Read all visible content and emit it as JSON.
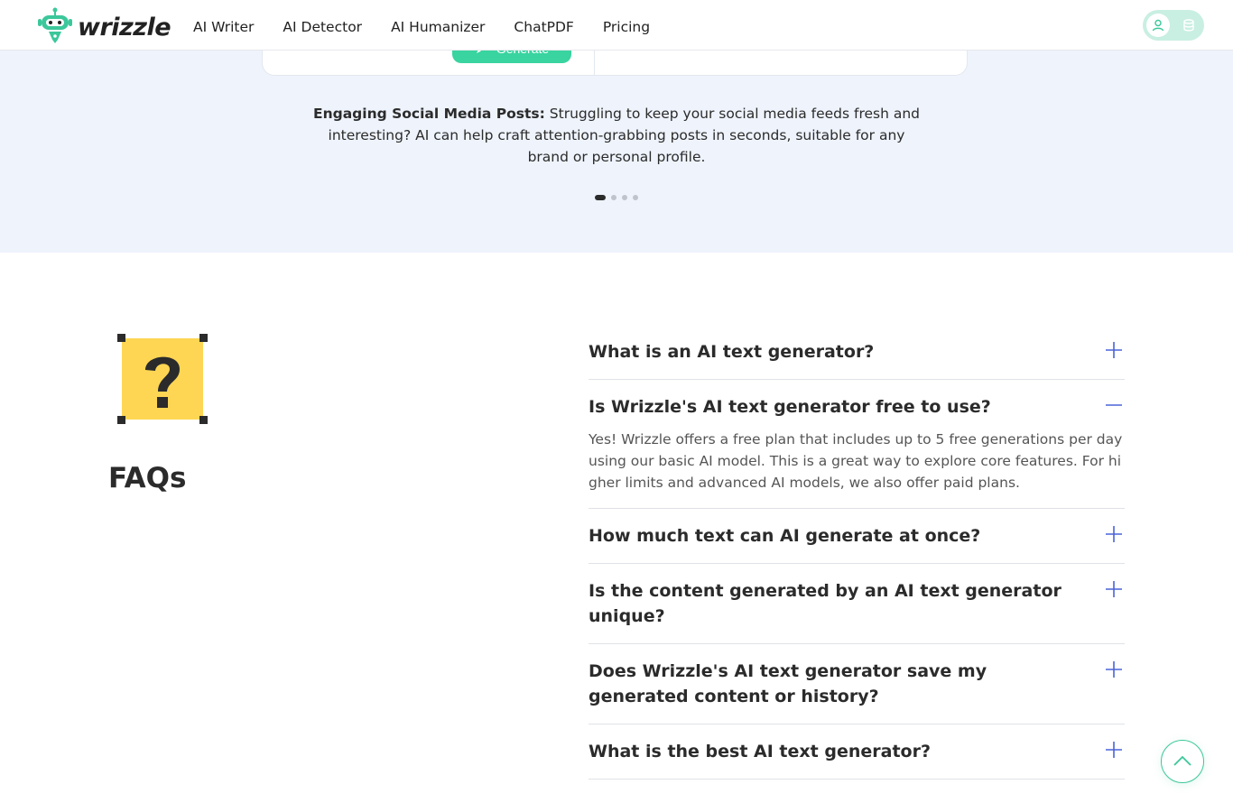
{
  "header": {
    "logo_text": "wrizzle",
    "nav": [
      "AI Writer",
      "AI Detector",
      "AI Humanizer",
      "ChatPDF",
      "Pricing"
    ]
  },
  "demo": {
    "button_label": "Generate"
  },
  "caption": {
    "bold": "Engaging Social Media Posts:",
    "text": " Struggling to keep your social media feeds fresh and interesting? AI can help craft attention-grabbing posts in seconds, suitable for any brand or personal profile."
  },
  "carousel": {
    "count": 4,
    "active": 1
  },
  "faq": {
    "title": "FAQs",
    "items": [
      {
        "q": "What is an AI text generator?",
        "open": false
      },
      {
        "q": "Is Wrizzle's AI text generator free to use?",
        "open": true,
        "a": "Yes! Wrizzle offers a free plan that includes up to 5 free generations per day using our basic AI model. This is a great way to explore core features. For higher limits and advanced AI models, we also offer paid plans."
      },
      {
        "q": "How much text can AI generate at once?",
        "open": false
      },
      {
        "q": "Is the content generated by an AI text generator unique?",
        "open": false
      },
      {
        "q": "Does Wrizzle's AI text generator save my generated content or history?",
        "open": false
      },
      {
        "q": "What is the best AI text generator?",
        "open": false
      }
    ]
  },
  "colors": {
    "accent": "#3cc79b",
    "plus": "#4a63d8",
    "band": "#eef3fc"
  }
}
